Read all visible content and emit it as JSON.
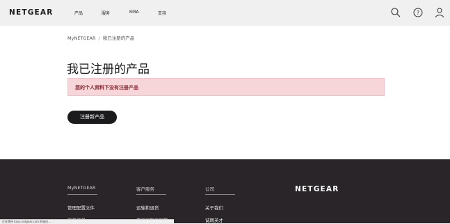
{
  "header": {
    "logo": "NETGEAR",
    "nav": [
      "产品",
      "服务",
      "RMA",
      "支持"
    ]
  },
  "breadcrumb": {
    "home": "MyNETGEAR",
    "separator": "/",
    "current": "我已注册的产品"
  },
  "main": {
    "title": "我已注册的产品",
    "alert": "您的个人资料下没有注册产品",
    "register_button": "注册新产品"
  },
  "footer": {
    "columns": [
      {
        "heading": "MyNETGEAR",
        "links": [
          "管理配置文件",
          "我的订单"
        ]
      },
      {
        "heading": "客户服务",
        "links": [
          "运输和退货",
          "常见问题与解答"
        ]
      },
      {
        "heading": "公司",
        "links": [
          "关于我们",
          "诚聘英才"
        ]
      }
    ],
    "logo": "NETGEAR"
  },
  "status_bar": "正在等待 kaus.netgear.com 的响应…",
  "colors": {
    "header_bg": "#f0f0f0",
    "alert_bg": "#f7d6da",
    "alert_text": "#8a2430",
    "button_bg": "#1b1a1c",
    "footer_bg": "#2a2528"
  }
}
